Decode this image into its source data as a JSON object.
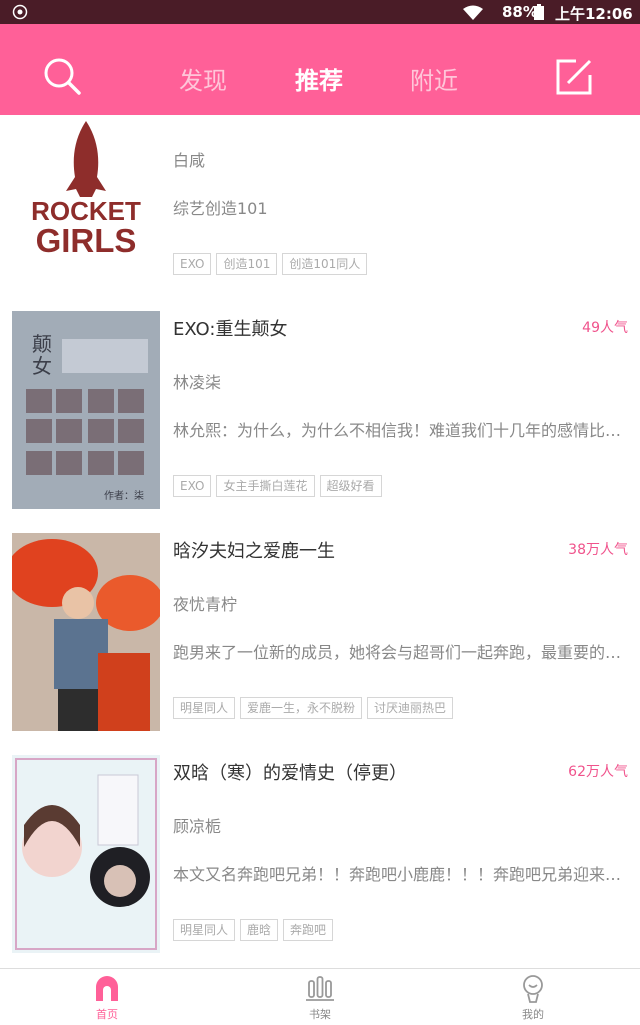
{
  "status_bar": {
    "battery": "88%",
    "time": "上午12:06"
  },
  "top_nav": {
    "tabs": [
      {
        "label": "发现"
      },
      {
        "label": "推荐"
      },
      {
        "label": "附近"
      }
    ]
  },
  "books": [
    {
      "title": "",
      "author": "白咸",
      "desc": "综艺创造101",
      "popularity": "",
      "cover_text": [
        "ROCKET",
        "GIRLS"
      ],
      "tags": [
        "EXO",
        "创造101",
        "创造101同人"
      ]
    },
    {
      "title": "EXO:重生颠女",
      "author": "林凌柒",
      "desc": "林允熙：为什么，为什么不相信我！难道我们十几年的感情比…",
      "popularity": "49人气",
      "cover_text": [
        "颠",
        "女",
        "作者：柒"
      ],
      "tags": [
        "EXO",
        "女主手撕白莲花",
        "超级好看"
      ]
    },
    {
      "title": "晗汐夫妇之爱鹿一生",
      "author": "夜忧青柠",
      "desc": "跑男来了一位新的成员，她将会与超哥们一起奔跑，最重要的…",
      "popularity": "38万人气",
      "tags": [
        "明星同人",
        "爱鹿一生，永不脱粉",
        "讨厌迪丽热巴"
      ]
    },
    {
      "title": "双晗（寒）的爱情史（停更）",
      "author": "顾凉栀",
      "desc": "本文又名奔跑吧兄弟！！奔跑吧小鹿鹿！！！奔跑吧兄弟迎来…",
      "popularity": "62万人气",
      "tags": [
        "明星同人",
        "鹿晗",
        "奔跑吧"
      ]
    }
  ],
  "bottom_nav": {
    "items": [
      {
        "label": "首页"
      },
      {
        "label": "书架"
      },
      {
        "label": "我的"
      }
    ]
  }
}
